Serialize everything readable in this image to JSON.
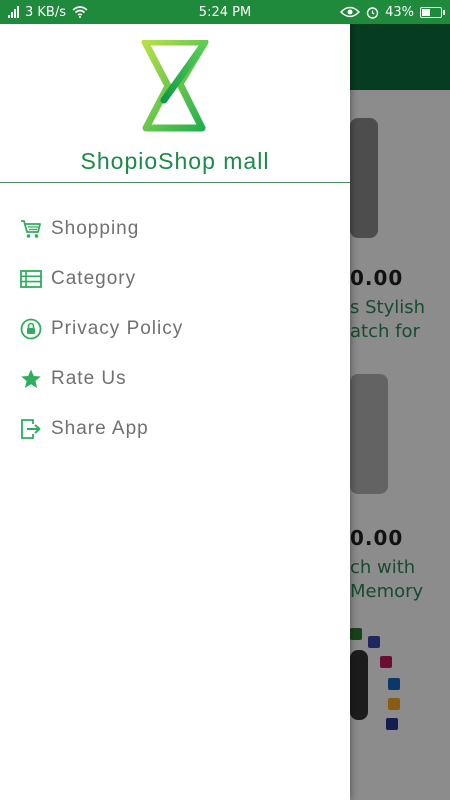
{
  "status_bar": {
    "speed": "3 KB/s",
    "time": "5:24 PM",
    "battery": "43%",
    "battery_level": 0.43
  },
  "drawer": {
    "brand": "ShopioShop mall",
    "menu": [
      {
        "label": "Shopping",
        "icon": "cart-icon"
      },
      {
        "label": "Category",
        "icon": "list-icon"
      },
      {
        "label": "Privacy Policy",
        "icon": "lock-icon"
      },
      {
        "label": "Rate Us",
        "icon": "star-icon"
      },
      {
        "label": "Share App",
        "icon": "share-icon"
      }
    ]
  },
  "background": {
    "price_1": "0.00",
    "text_1a": "s Stylish",
    "text_1b": "atch for",
    "price_2": "0.00",
    "text_2a": "ch with",
    "text_2b": "Memory"
  },
  "colors": {
    "accent": "#1f8a3c",
    "toolbar": "#0b6e3b",
    "menu_icon": "#2eae5c",
    "menu_text": "#707070"
  }
}
